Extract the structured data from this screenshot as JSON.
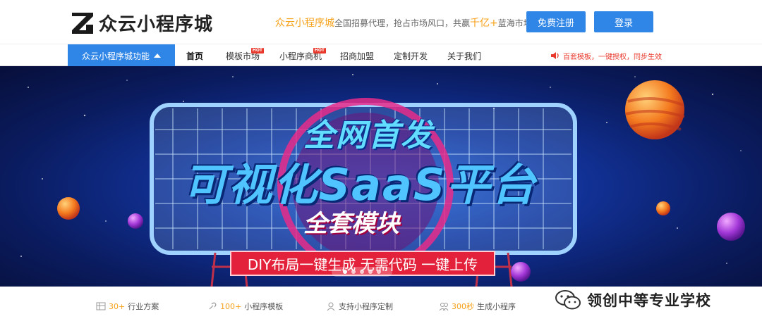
{
  "header": {
    "logo_text": "众云小程序城",
    "slogan": {
      "brand": "众云小程序城",
      "part1": "全国招募代理，抢占市场风口，共赢",
      "highlight": "千亿+",
      "part2": "蓝海市场"
    },
    "register_label": "免费注册",
    "login_label": "登录"
  },
  "nav": {
    "func_label": "众云小程序城功能",
    "items": [
      {
        "label": "首页",
        "hot": false
      },
      {
        "label": "模板市场",
        "hot": true
      },
      {
        "label": "小程序商机",
        "hot": true
      },
      {
        "label": "招商加盟",
        "hot": false
      },
      {
        "label": "定制开发",
        "hot": false
      },
      {
        "label": "关于我们",
        "hot": false
      }
    ],
    "hot_badge": "HOT",
    "notice": "百套模板，一键授权，同步生效"
  },
  "banner": {
    "title1": "全网首发",
    "title2": "可视化SaaS平台",
    "title3": "全套模块",
    "ribbon": "DIY布局一键生成 无需代码 一键上传",
    "slide_count": 5,
    "active_slide": 1
  },
  "features": [
    {
      "num": "30+",
      "text": "行业方案",
      "icon": "industry-icon"
    },
    {
      "num": "100+",
      "text": "小程序模板",
      "icon": "template-icon"
    },
    {
      "num": "",
      "text": "支持小程序定制",
      "icon": "user-icon"
    },
    {
      "num": "300秒",
      "text": "生成小程序",
      "icon": "users-icon"
    },
    {
      "num": "",
      "text": "",
      "icon": "data-icon"
    }
  ],
  "watermark": {
    "text": "领创中等专业学校",
    "icon": "wechat-icon"
  },
  "colors": {
    "accent": "#2f86e6",
    "orange": "#f7a21b",
    "red": "#e8382b"
  }
}
